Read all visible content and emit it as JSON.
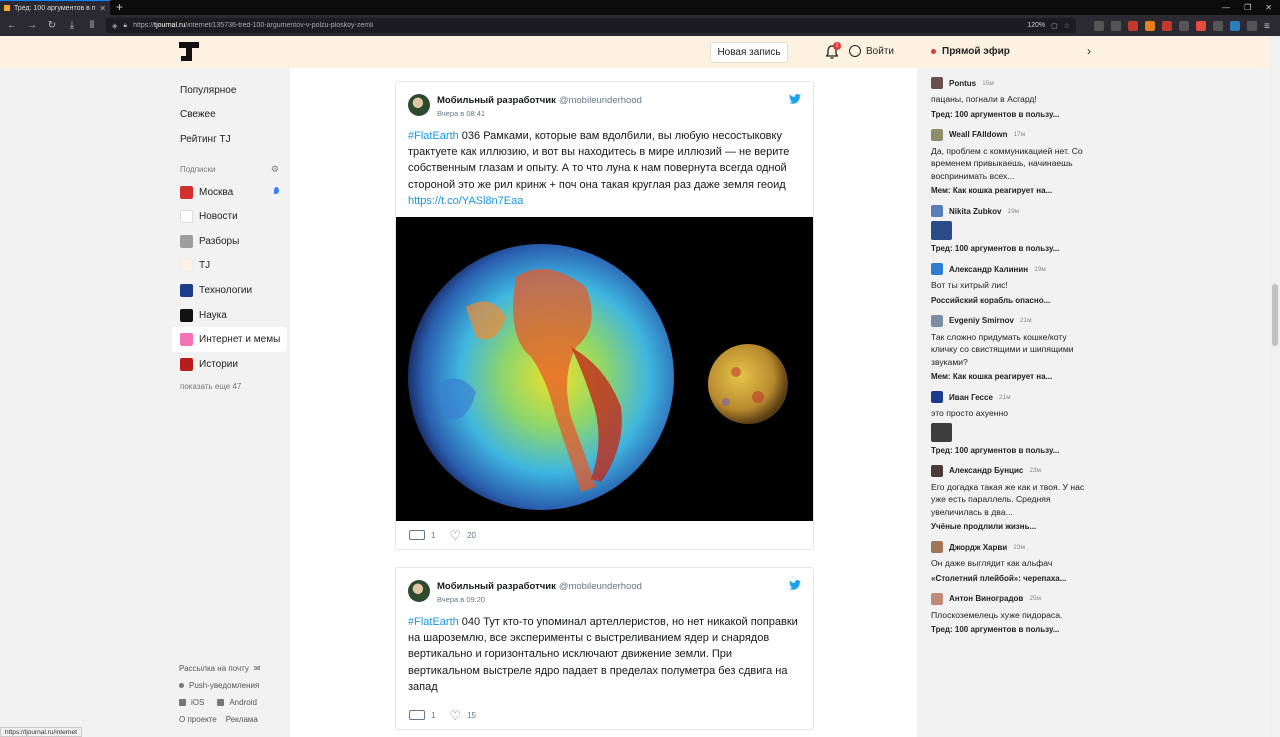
{
  "browser": {
    "tab_title": "Тред: 100 аргументов в пол...",
    "url_host": "tjournal.ru",
    "url_path": "/internet/135736-tred-100-argumentov-v-polzu-ploskoy-zemli",
    "url_prefix": "https://",
    "zoom": "120%",
    "status_url": "https://tjournal.ru/internet"
  },
  "header": {
    "new_post": "Новая запись",
    "notif_count": "1",
    "login": "Войти",
    "live": "Прямой эфир"
  },
  "left_nav": {
    "items": [
      "Популярное",
      "Свежее",
      "Рейтинг TJ"
    ],
    "subs_title": "Подписки",
    "subs": [
      {
        "label": "Москва",
        "color": "#d32f2f"
      },
      {
        "label": "Новости",
        "color": "#ffffff"
      },
      {
        "label": "Разборы",
        "color": "#9e9e9e"
      },
      {
        "label": "TJ",
        "color": "#ffffff"
      },
      {
        "label": "Технологии",
        "color": "#1e3a8a"
      },
      {
        "label": "Наука",
        "color": "#111111"
      },
      {
        "label": "Интернет и мемы",
        "color": "#f472b6"
      },
      {
        "label": "Истории",
        "color": "#b91c1c"
      }
    ],
    "show_more": "показать еще 47"
  },
  "left_footer": {
    "newsletter": "Рассылка на почту",
    "push": "Push-уведомления",
    "ios": "iOS",
    "android": "Android",
    "about": "О проекте",
    "ads": "Реклама"
  },
  "tweets": [
    {
      "author": "Мобильный разработчик",
      "handle": "@mobileunderhood",
      "time": "Вчера в 08:41",
      "tag": "#FlatEarth",
      "text": " 036 Рамками, которые вам вдолбили, вы любую несостыковку трактуете как иллюзию, и вот вы находитесь в мире иллюзий — не верите собственным глазам и опыту. А то что луна к нам повернута всегда одной стороной это же рил кринж + поч она такая круглая раз даже земля геоид ",
      "link": "https://t.co/YASl8n7Eaa",
      "retweets": "1",
      "likes": "20"
    },
    {
      "author": "Мобильный разработчик",
      "handle": "@mobileunderhood",
      "time": "Вчера в 09:20",
      "tag": "#FlatEarth",
      "text": " 040 Тут кто-то упоминал артеллеристов, но нет никакой поправки на шароземлю, все эксперименты с выстреливанием ядер и снарядов вертикально и горизонтально исключают движение земли. При вертикальном выстреле ядро падает в пределах полуметра без сдвига на запад",
      "link": "",
      "retweets": "1",
      "likes": "15"
    }
  ],
  "feed": [
    {
      "name": "Pontus",
      "time": "15м",
      "text": "пацаны, погнали в Асгард!",
      "topic": "Тред: 100 аргументов в пользу...",
      "color": "#6b4f4f",
      "image": false
    },
    {
      "name": "Weall FAlldown",
      "time": "17м",
      "text": "Да, проблем с коммуникацией нет. Со временем привыкаешь, начинаешь воспринимать всех...",
      "topic": "Мем: Как кошка реагирует на...",
      "color": "#8d8d6b",
      "image": false
    },
    {
      "name": "Nikita Zubkov",
      "time": "19м",
      "text": "",
      "topic": "Тред: 100 аргументов в пользу...",
      "color": "#5a7db5",
      "image": true,
      "image_color": "#2b4a8a"
    },
    {
      "name": "Александр Калинин",
      "time": "19м",
      "text": "Вот ты хитрый лис!",
      "topic": "Российский корабль опасно...",
      "color": "#2e7dd1",
      "image": false
    },
    {
      "name": "Evgeniy Smirnov",
      "time": "21м",
      "text": "Так сложно придумать кошке/коту кличку со свистящими и шипящими звуками?",
      "topic": "Мем: Как кошка реагирует на...",
      "color": "#7a8fa3",
      "image": false
    },
    {
      "name": "Иван Гессе",
      "time": "21м",
      "text": "это просто ахуенно",
      "topic": "Тред: 100 аргументов в пользу...",
      "color": "#1e3a8a",
      "image": true,
      "image_color": "#3d3d3d"
    },
    {
      "name": "Александр Бунцис",
      "time": "23м",
      "text": "Его догадка такая же как и твоя. У нас уже есть параллель. Средняя увеличилась в два...",
      "topic": "Учёные продлили жизнь...",
      "color": "#4a3a3a",
      "image": false
    },
    {
      "name": "Джордж Харви",
      "time": "23м",
      "text": "Он даже выглядит как альфач",
      "topic": "«Столетний плейбой»: черепаха...",
      "color": "#a0755a",
      "image": false
    },
    {
      "name": "Антон Виноградов",
      "time": "25м",
      "text": "Плоскоземелець хуже пидораса.",
      "topic": "Тред: 100 аргументов в пользу...",
      "color": "#c08a7a",
      "image": false
    }
  ]
}
